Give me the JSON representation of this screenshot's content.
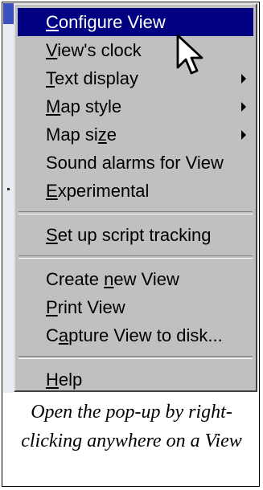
{
  "menu": {
    "items": [
      {
        "pre": "",
        "ul": "C",
        "post": "onfigure View",
        "submenu": false,
        "highlighted": true
      },
      {
        "pre": "",
        "ul": "V",
        "post": "iew's clock",
        "submenu": false,
        "highlighted": false
      },
      {
        "pre": "",
        "ul": "T",
        "post": "ext display",
        "submenu": true,
        "highlighted": false
      },
      {
        "pre": "",
        "ul": "M",
        "post": "ap style",
        "submenu": true,
        "highlighted": false
      },
      {
        "pre": "Map si",
        "ul": "z",
        "post": "e",
        "submenu": true,
        "highlighted": false
      },
      {
        "pre": "Sound alarms for View",
        "ul": "",
        "post": "",
        "submenu": false,
        "highlighted": false
      },
      {
        "pre": "",
        "ul": "E",
        "post": "xperimental",
        "submenu": false,
        "highlighted": false
      },
      {
        "pre": "",
        "ul": "S",
        "post": "et up script tracking",
        "submenu": false,
        "highlighted": false
      },
      {
        "pre": "Create ",
        "ul": "n",
        "post": "ew View",
        "submenu": false,
        "highlighted": false
      },
      {
        "pre": "",
        "ul": "P",
        "post": "rint View",
        "submenu": false,
        "highlighted": false
      },
      {
        "pre": "C",
        "ul": "a",
        "post": "pture View to disk...",
        "submenu": false,
        "highlighted": false
      },
      {
        "pre": "",
        "ul": "H",
        "post": "elp",
        "submenu": false,
        "highlighted": false
      }
    ]
  },
  "caption": "Open the pop-up by right-clicking anywhere on a View",
  "colors": {
    "menu_bg": "#c0c0c0",
    "highlight_bg": "#000080",
    "highlight_text": "#ffffff"
  },
  "icons": {
    "cursor": "arrow-pointer-icon",
    "submenu": "submenu-arrow-icon"
  }
}
